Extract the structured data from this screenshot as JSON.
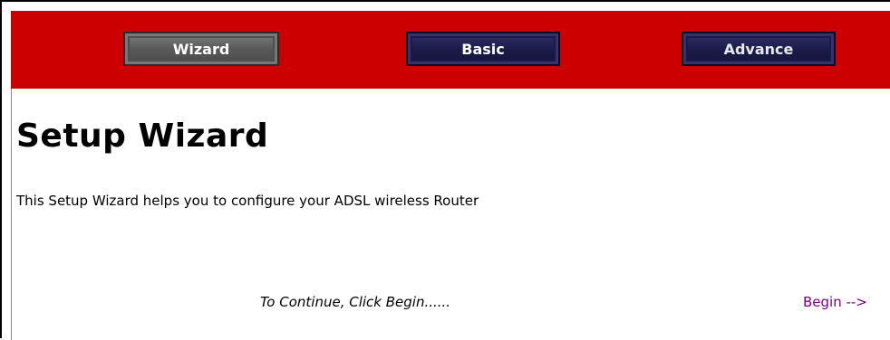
{
  "nav": {
    "wizard_label": "Wizard",
    "basic_label": "Basic",
    "advance_label": "Advance"
  },
  "main": {
    "title": "Setup Wizard",
    "description": "This Setup Wizard helps you to configure your ADSL wireless Router",
    "continue_text": "To Continue, Click Begin......",
    "begin_link": "Begin -->"
  },
  "colors": {
    "top_bar": "#cc0000",
    "wizard_button": "#5a5a5a",
    "nav_button": "#1c1c4c",
    "link": "#800080"
  }
}
